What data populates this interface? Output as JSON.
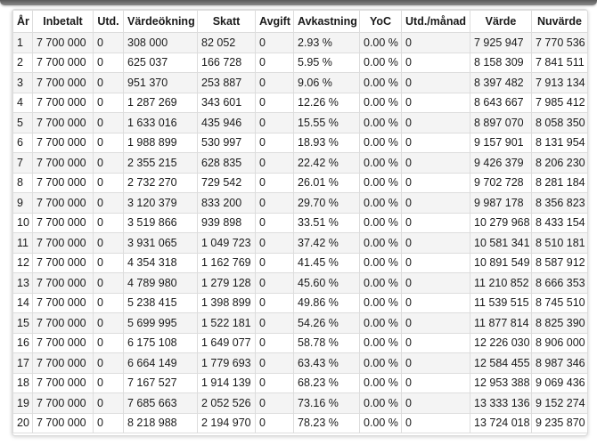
{
  "headers": {
    "year": "År",
    "paid_in": "Inbetalt",
    "dividend": "Utd.",
    "value_increase": "Värdeökning",
    "tax": "Skatt",
    "fee": "Avgift",
    "return": "Avkastning",
    "yoc": "YoC",
    "dividend_month": "Utd./månad",
    "value": "Värde",
    "present_value": "Nuvärde"
  },
  "rows": [
    [
      "1",
      "7 700 000",
      "0",
      "308 000",
      "82 052",
      "0",
      "2.93 %",
      "0.00 %",
      "0",
      "7 925 947",
      "7 770 536"
    ],
    [
      "2",
      "7 700 000",
      "0",
      "625 037",
      "166 728",
      "0",
      "5.95 %",
      "0.00 %",
      "0",
      "8 158 309",
      "7 841 511"
    ],
    [
      "3",
      "7 700 000",
      "0",
      "951 370",
      "253 887",
      "0",
      "9.06 %",
      "0.00 %",
      "0",
      "8 397 482",
      "7 913 134"
    ],
    [
      "4",
      "7 700 000",
      "0",
      "1 287 269",
      "343 601",
      "0",
      "12.26 %",
      "0.00 %",
      "0",
      "8 643 667",
      "7 985 412"
    ],
    [
      "5",
      "7 700 000",
      "0",
      "1 633 016",
      "435 946",
      "0",
      "15.55 %",
      "0.00 %",
      "0",
      "8 897 070",
      "8 058 350"
    ],
    [
      "6",
      "7 700 000",
      "0",
      "1 988 899",
      "530 997",
      "0",
      "18.93 %",
      "0.00 %",
      "0",
      "9 157 901",
      "8 131 954"
    ],
    [
      "7",
      "7 700 000",
      "0",
      "2 355 215",
      "628 835",
      "0",
      "22.42 %",
      "0.00 %",
      "0",
      "9 426 379",
      "8 206 230"
    ],
    [
      "8",
      "7 700 000",
      "0",
      "2 732 270",
      "729 542",
      "0",
      "26.01 %",
      "0.00 %",
      "0",
      "9 702 728",
      "8 281 184"
    ],
    [
      "9",
      "7 700 000",
      "0",
      "3 120 379",
      "833 200",
      "0",
      "29.70 %",
      "0.00 %",
      "0",
      "9 987 178",
      "8 356 823"
    ],
    [
      "10",
      "7 700 000",
      "0",
      "3 519 866",
      "939 898",
      "0",
      "33.51 %",
      "0.00 %",
      "0",
      "10 279 968",
      "8 433 154"
    ],
    [
      "11",
      "7 700 000",
      "0",
      "3 931 065",
      "1 049 723",
      "0",
      "37.42 %",
      "0.00 %",
      "0",
      "10 581 341",
      "8 510 181"
    ],
    [
      "12",
      "7 700 000",
      "0",
      "4 354 318",
      "1 162 769",
      "0",
      "41.45 %",
      "0.00 %",
      "0",
      "10 891 549",
      "8 587 912"
    ],
    [
      "13",
      "7 700 000",
      "0",
      "4 789 980",
      "1 279 128",
      "0",
      "45.60 %",
      "0.00 %",
      "0",
      "11 210 852",
      "8 666 353"
    ],
    [
      "14",
      "7 700 000",
      "0",
      "5 238 415",
      "1 398 899",
      "0",
      "49.86 %",
      "0.00 %",
      "0",
      "11 539 515",
      "8 745 510"
    ],
    [
      "15",
      "7 700 000",
      "0",
      "5 699 995",
      "1 522 181",
      "0",
      "54.26 %",
      "0.00 %",
      "0",
      "11 877 814",
      "8 825 390"
    ],
    [
      "16",
      "7 700 000",
      "0",
      "6 175 108",
      "1 649 077",
      "0",
      "58.78 %",
      "0.00 %",
      "0",
      "12 226 030",
      "8 906 000"
    ],
    [
      "17",
      "7 700 000",
      "0",
      "6 664 149",
      "1 779 693",
      "0",
      "63.43 %",
      "0.00 %",
      "0",
      "12 584 455",
      "8 987 346"
    ],
    [
      "18",
      "7 700 000",
      "0",
      "7 167 527",
      "1 914 139",
      "0",
      "68.23 %",
      "0.00 %",
      "0",
      "12 953 388",
      "9 069 436"
    ],
    [
      "19",
      "7 700 000",
      "0",
      "7 685 663",
      "2 052 526",
      "0",
      "73.16 %",
      "0.00 %",
      "0",
      "13 333 136",
      "9 152 274"
    ],
    [
      "20",
      "7 700 000",
      "0",
      "8 218 988",
      "2 194 970",
      "0",
      "78.23 %",
      "0.00 %",
      "0",
      "13 724 018",
      "9 235 870"
    ]
  ]
}
